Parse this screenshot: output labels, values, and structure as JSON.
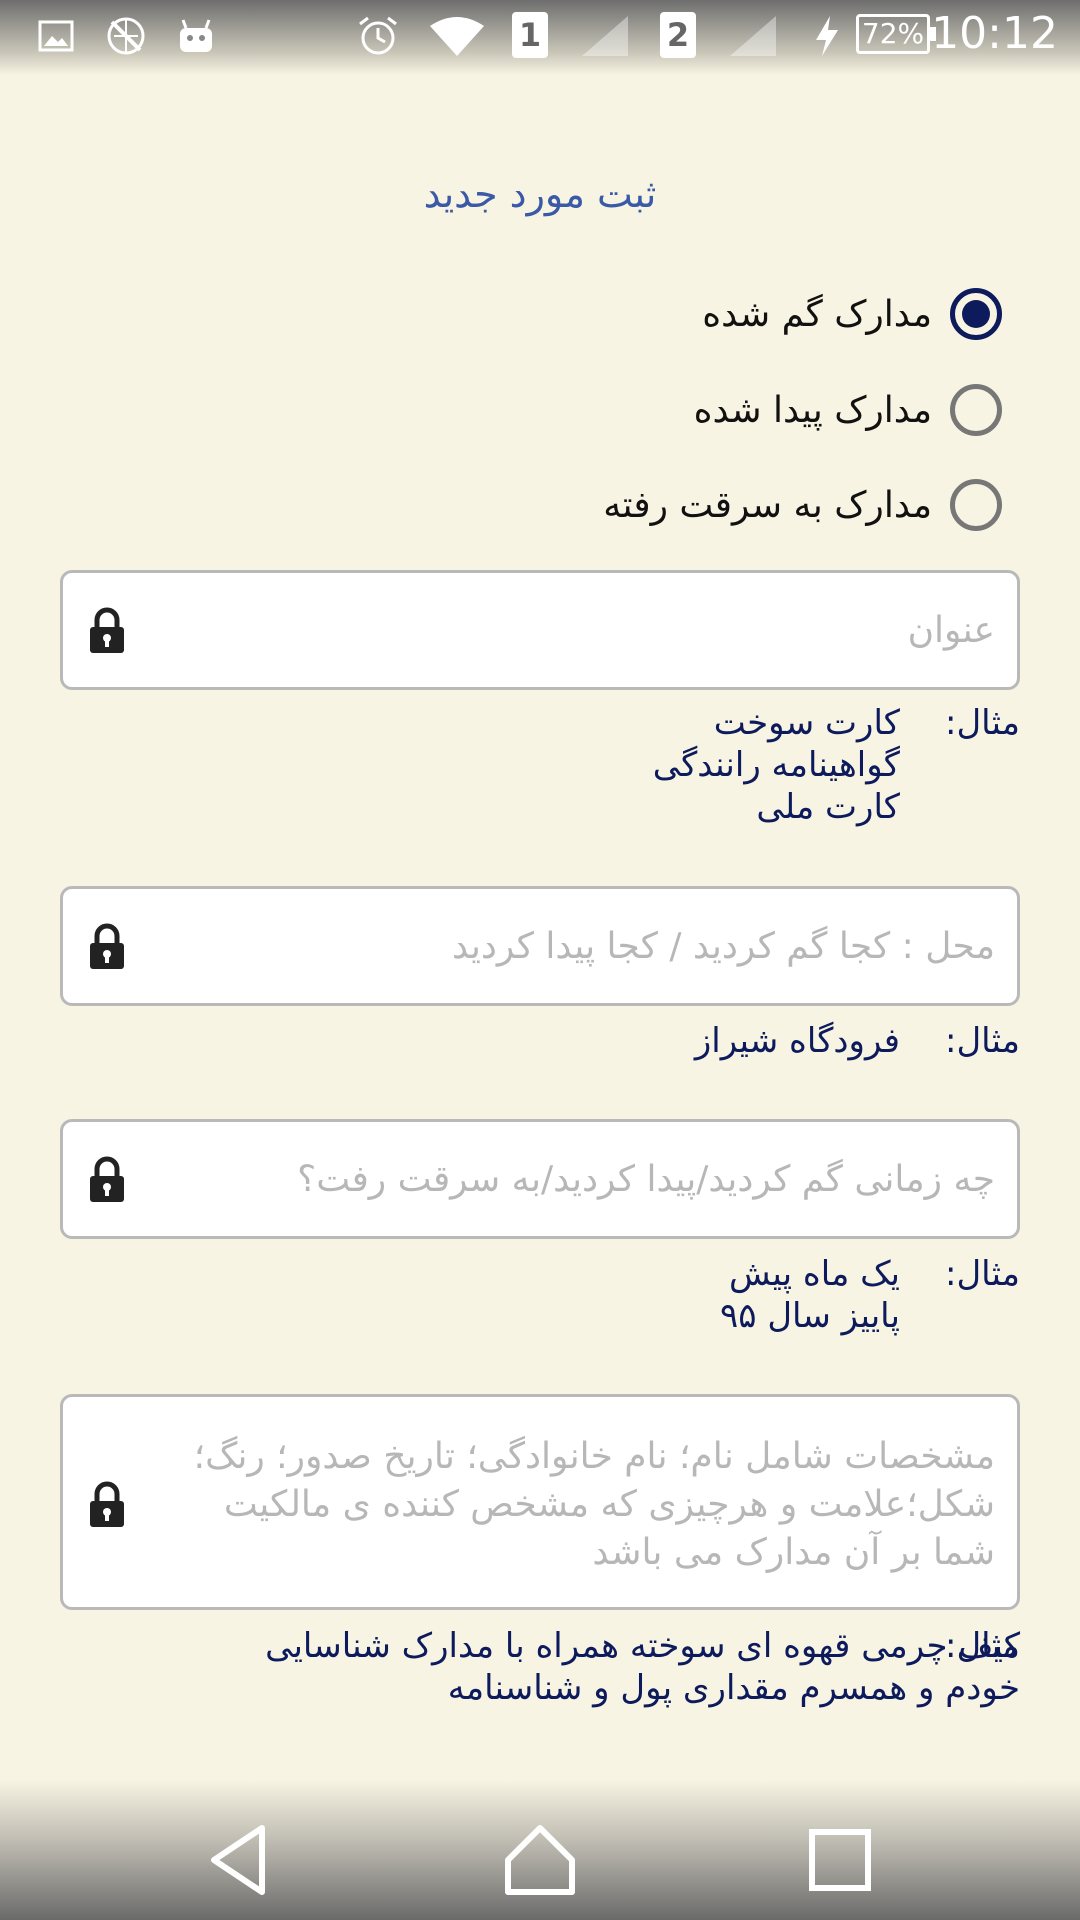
{
  "status_bar": {
    "sim1": "1",
    "sim2": "2",
    "battery": "72%",
    "time": "10:12",
    "icons": [
      "gallery-icon",
      "no-sync-icon",
      "android-icon",
      "alarm-icon",
      "wifi-icon",
      "signal-icon",
      "signal-icon",
      "charging-icon",
      "battery-icon"
    ]
  },
  "title": "ثبت مورد جدید",
  "radio_options": [
    {
      "label": "مدارک گم شده",
      "checked": true
    },
    {
      "label": "مدارک پیدا شده",
      "checked": false
    },
    {
      "label": "مدارک به سرقت رفته",
      "checked": false
    }
  ],
  "fields": [
    {
      "placeholder": "عنوان",
      "icon": "lock-icon"
    },
    {
      "placeholder": "محل : کجا گم کردید / کجا پیدا کردید",
      "icon": "lock-icon"
    },
    {
      "placeholder": "چه زمانی گم کردید/پیدا کردید/به سرقت رفت؟",
      "icon": "lock-icon"
    },
    {
      "placeholder": "مشخصات شامل نام؛ نام خانوادگی؛ تاریخ صدور؛ رنگ؛شکل؛علامت و هرچیزی که مشخص کننده ی مالکیت شما بر آن مدارک می باشد",
      "icon": "lock-icon"
    }
  ],
  "examples": [
    {
      "label": "مثال:",
      "text": "کارت سوخت\nگواهینامه رانندگی\nکارت ملی"
    },
    {
      "label": "مثال:",
      "text": "فرودگاه شیراز"
    },
    {
      "label": "مثال:",
      "text": "یک ماه پیش\nپاییز سال ۹۵"
    },
    {
      "label": "مثال:",
      "text": "کیف چرمی قهوه ای سوخته همراه با مدارک شناسایی\nخودم و همسرم مقداری پول و شناسنامه"
    }
  ],
  "nav": [
    "back-icon",
    "home-icon",
    "recents-icon"
  ]
}
